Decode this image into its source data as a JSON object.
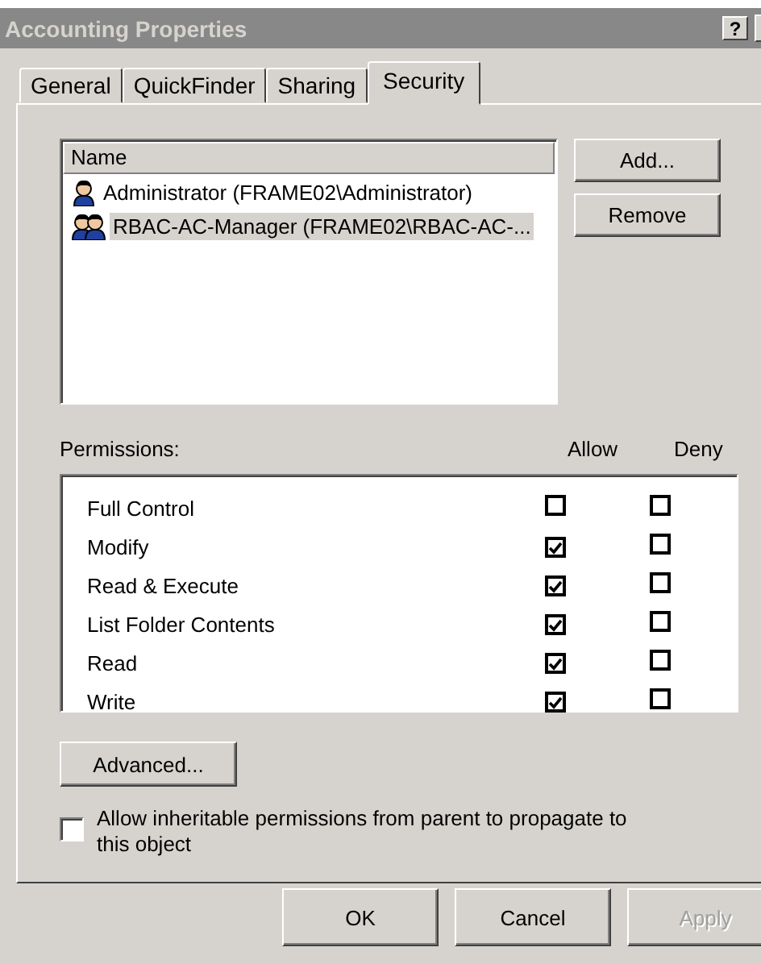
{
  "window": {
    "title": "Accounting Properties",
    "help_button": "?"
  },
  "tabs": [
    {
      "label": "General",
      "selected": false
    },
    {
      "label": "QuickFinder",
      "selected": false
    },
    {
      "label": "Sharing",
      "selected": false
    },
    {
      "label": "Security",
      "selected": true
    }
  ],
  "users": {
    "column": "Name",
    "items": [
      {
        "name": "Administrator (FRAME02\\Administrator)",
        "kind": "user",
        "selected": false
      },
      {
        "name": "RBAC-AC-Manager (FRAME02\\RBAC-AC-...",
        "kind": "group",
        "selected": true
      }
    ]
  },
  "user_buttons": [
    "Add...",
    "Remove"
  ],
  "permissions": {
    "label": "Permissions:",
    "allow_header": "Allow",
    "deny_header": "Deny",
    "rows": [
      {
        "name": "Full Control",
        "allow": false,
        "deny": false
      },
      {
        "name": "Modify",
        "allow": true,
        "deny": false
      },
      {
        "name": "Read & Execute",
        "allow": true,
        "deny": false
      },
      {
        "name": "List Folder Contents",
        "allow": true,
        "deny": false
      },
      {
        "name": "Read",
        "allow": true,
        "deny": false
      },
      {
        "name": "Write",
        "allow": true,
        "deny": false
      }
    ]
  },
  "advanced_button": "Advanced...",
  "inherit": {
    "label": "Allow inheritable permissions from parent to propagate to this object",
    "checked": false
  },
  "footer_buttons": [
    {
      "label": "OK",
      "disabled": false
    },
    {
      "label": "Cancel",
      "disabled": false
    },
    {
      "label": "Apply",
      "disabled": true
    }
  ]
}
